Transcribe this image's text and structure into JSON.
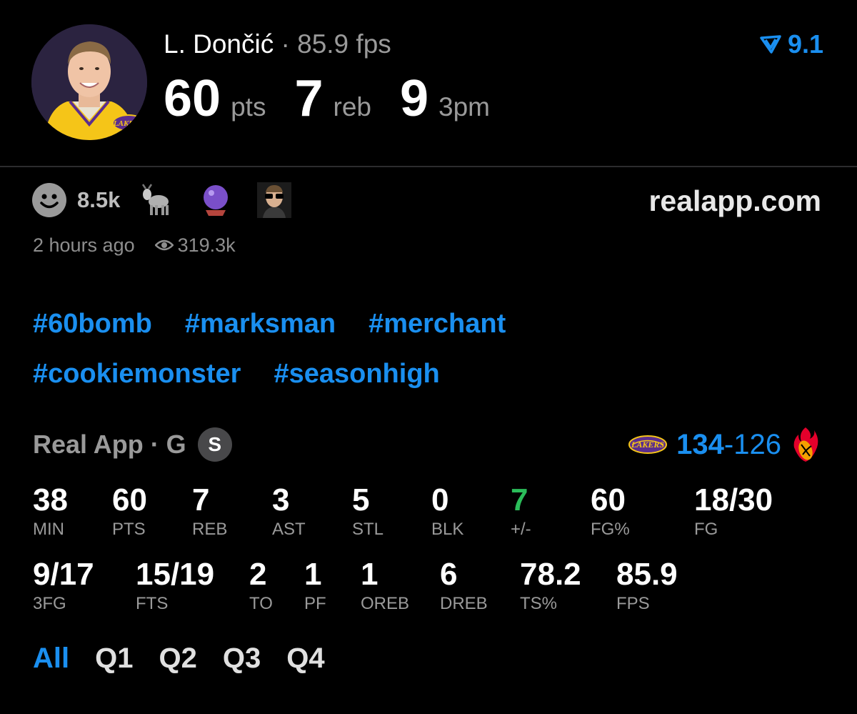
{
  "header": {
    "player_name": "L. Dončić",
    "separator": "·",
    "fps_label": "85.9 fps",
    "headline_stats": [
      {
        "value": "60",
        "unit": "pts"
      },
      {
        "value": "7",
        "unit": "reb"
      },
      {
        "value": "9",
        "unit": "3pm"
      }
    ],
    "rank_value": "9.1",
    "accent_color": "#1a8ff0"
  },
  "reactions": {
    "count": "8.5k",
    "icons": [
      "smiley-icon",
      "goat-icon",
      "crystal-ball-icon",
      "sunglasses-player-icon"
    ],
    "site": "realapp.com"
  },
  "meta": {
    "time_ago": "2 hours ago",
    "views": "319.3k"
  },
  "hashtags": [
    [
      "#60bomb",
      "#marksman",
      "#merchant"
    ],
    [
      "#cookiemonster",
      "#seasonhigh"
    ]
  ],
  "game": {
    "source": "Real App · G",
    "badge": "S",
    "home_score": "134",
    "dash": "-",
    "away_score": "126",
    "home_team_logo": "lakers-logo",
    "away_team_logo": "heat-logo"
  },
  "stats": {
    "row1": [
      {
        "value": "38",
        "label": "MIN"
      },
      {
        "value": "60",
        "label": "PTS"
      },
      {
        "value": "7",
        "label": "REB"
      },
      {
        "value": "3",
        "label": "AST"
      },
      {
        "value": "5",
        "label": "STL"
      },
      {
        "value": "0",
        "label": "BLK"
      },
      {
        "value": "7",
        "label": "+/-",
        "color": "#2bbd5a"
      },
      {
        "value": "60",
        "label": "FG%"
      },
      {
        "value": "18/30",
        "label": "FG"
      }
    ],
    "row2": [
      {
        "value": "9/17",
        "label": "3FG"
      },
      {
        "value": "15/19",
        "label": "FTS"
      },
      {
        "value": "2",
        "label": "TO"
      },
      {
        "value": "1",
        "label": "PF"
      },
      {
        "value": "1",
        "label": "OREB"
      },
      {
        "value": "6",
        "label": "DREB"
      },
      {
        "value": "78.2",
        "label": "TS%"
      },
      {
        "value": "85.9",
        "label": "FPS"
      }
    ]
  },
  "quarter_tabs": {
    "items": [
      "All",
      "Q1",
      "Q2",
      "Q3",
      "Q4"
    ],
    "active": "All"
  }
}
